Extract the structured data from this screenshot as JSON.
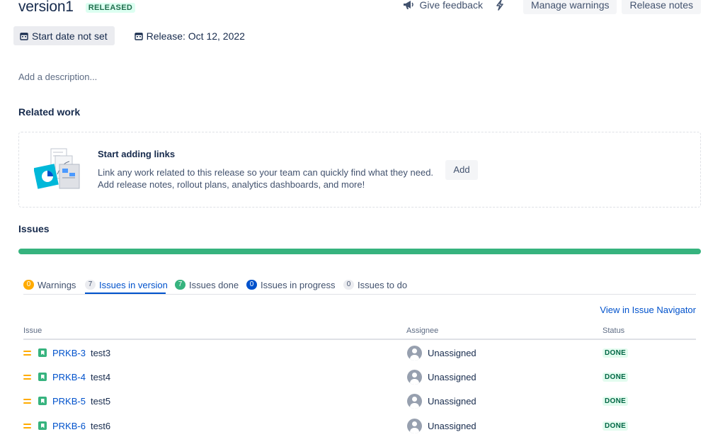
{
  "version": {
    "title": "version1",
    "status_badge": "RELEASED"
  },
  "header_actions": {
    "feedback_label": "Give feedback",
    "manage_warnings_label": "Manage warnings",
    "release_notes_label": "Release notes"
  },
  "dates": {
    "start_label": "Start date not set",
    "release_label": "Release: Oct 12, 2022"
  },
  "description_placeholder": "Add a description...",
  "related_work": {
    "heading": "Related work",
    "title": "Start adding links",
    "text_line1": "Link any work related to this release so your team can quickly find what they need.",
    "text_line2": "Add release notes, rollout plans, analytics dashboards, and more!",
    "add_label": "Add"
  },
  "issues": {
    "heading": "Issues",
    "progress_done_fraction": 1.0,
    "progress_color": "#36b37e",
    "tabs": [
      {
        "count": "0",
        "label": "Warnings",
        "active": false
      },
      {
        "count": "7",
        "label": "Issues in version",
        "active": true
      },
      {
        "count": "7",
        "label": "Issues done",
        "active": false
      },
      {
        "count": "0",
        "label": "Issues in progress",
        "active": false
      },
      {
        "count": "0",
        "label": "Issues to do",
        "active": false
      }
    ],
    "navigator_link": "View in Issue Navigator",
    "columns": {
      "issue": "Issue",
      "assignee": "Assignee",
      "status": "Status"
    },
    "rows": [
      {
        "key": "PRKB-3",
        "summary": "test3",
        "assignee": "Unassigned",
        "status": "DONE",
        "priority_icon": "priority-medium-icon",
        "type_icon": "story-icon"
      },
      {
        "key": "PRKB-4",
        "summary": "test4",
        "assignee": "Unassigned",
        "status": "DONE",
        "priority_icon": "priority-medium-icon",
        "type_icon": "story-icon"
      },
      {
        "key": "PRKB-5",
        "summary": "test5",
        "assignee": "Unassigned",
        "status": "DONE",
        "priority_icon": "priority-medium-icon",
        "type_icon": "story-icon"
      },
      {
        "key": "PRKB-6",
        "summary": "test6",
        "assignee": "Unassigned",
        "status": "DONE",
        "priority_icon": "priority-medium-icon",
        "type_icon": "story-icon"
      }
    ]
  }
}
